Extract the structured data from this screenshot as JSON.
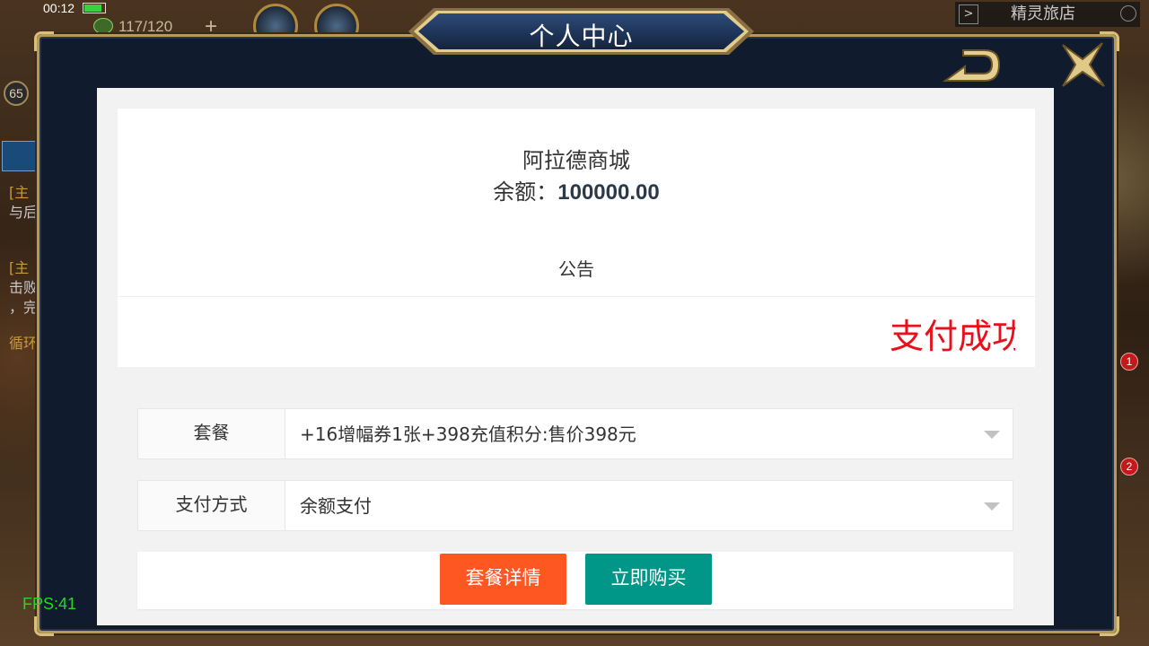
{
  "hud": {
    "clock": "00:12",
    "battery_level": 0.85,
    "energy": "117/120",
    "plus": "+",
    "level": "65",
    "shop_label": "精灵旅店",
    "quests": [
      "[主",
      "与后",
      "[主",
      "击败",
      "，完",
      "循环"
    ],
    "badges": [
      "1",
      "2"
    ],
    "fps": "FPS:41"
  },
  "modal": {
    "title": "个人中心"
  },
  "web": {
    "store_name": "阿拉德商城",
    "balance_label": "余额：",
    "balance_value": "100000.00",
    "notice_title": "公告",
    "marquee": "支付成功",
    "package_label": "套餐",
    "package_value": "+16增幅券1张+398充值积分:售价398元",
    "payment_label": "支付方式",
    "payment_value": "余额支付",
    "detail_button": "套餐详情",
    "buy_button": "立即购买"
  },
  "colors": {
    "modal_bg": "#101b2d",
    "gold": "#b69a5c",
    "marquee_red": "#e8101a",
    "detail_orange": "#ff5722",
    "buy_teal": "#009688",
    "fps_green": "#22d822"
  }
}
